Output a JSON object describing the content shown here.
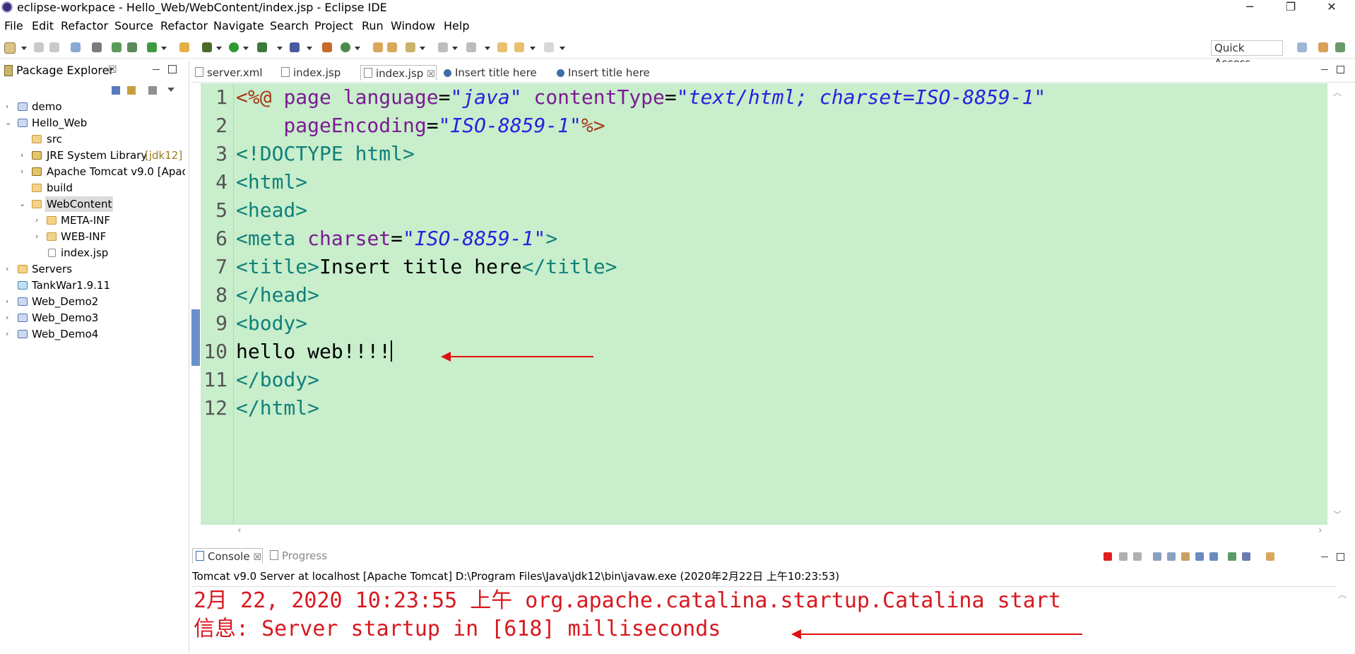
{
  "window": {
    "title": "eclipse-workpace - Hello_Web/WebContent/index.jsp - Eclipse IDE",
    "minimize": "─",
    "restore": "❐",
    "close": "✕"
  },
  "menu": [
    "File",
    "Edit",
    "Refactor",
    "Source",
    "Refactor",
    "Navigate",
    "Search",
    "Project",
    "Run",
    "Window",
    "Help"
  ],
  "toolbar": {
    "quick_access": "Quick Access"
  },
  "package_explorer": {
    "title": "Package Explorer",
    "close": "☒",
    "items": [
      {
        "label": "demo",
        "extra": ""
      },
      {
        "label": "Hello_Web",
        "extra": ""
      },
      {
        "label": "src",
        "extra": ""
      },
      {
        "label": "JRE System Library",
        "extra": "[jdk12]"
      },
      {
        "label": "Apache Tomcat v9.0 [Apac",
        "extra": ""
      },
      {
        "label": "build",
        "extra": ""
      },
      {
        "label": "WebContent",
        "extra": ""
      },
      {
        "label": "META-INF",
        "extra": ""
      },
      {
        "label": "WEB-INF",
        "extra": ""
      },
      {
        "label": "index.jsp",
        "extra": ""
      },
      {
        "label": "Servers",
        "extra": ""
      },
      {
        "label": "TankWar1.9.11",
        "extra": ""
      },
      {
        "label": "Web_Demo2",
        "extra": ""
      },
      {
        "label": "Web_Demo3",
        "extra": ""
      },
      {
        "label": "Web_Demo4",
        "extra": ""
      }
    ]
  },
  "editor": {
    "tabs": [
      "server.xml",
      "index.jsp",
      "index.jsp",
      "Insert title here",
      "Insert title here"
    ],
    "tab_close": "☒",
    "line_numbers": [
      "1",
      "2",
      "3",
      "4",
      "5",
      "6",
      "7",
      "8",
      "9",
      "10",
      "11",
      "12"
    ],
    "code": {
      "l1": [
        "<%@ ",
        "page ",
        "language",
        "=",
        "\"java\"",
        " contentType",
        "=",
        "\"text/html; charset=ISO-8859-1\""
      ],
      "l2": [
        "    pageEncoding",
        "=",
        "\"ISO-8859-1\"",
        "%>"
      ],
      "l3": [
        "<!DOCTYPE ",
        "html",
        ">"
      ],
      "l4": "<html>",
      "l5": "<head>",
      "l6": [
        "<meta ",
        "charset",
        "=",
        "\"ISO-8859-1\"",
        ">"
      ],
      "l7": [
        "<title>",
        "Insert title here",
        "</title>"
      ],
      "l8": "</head>",
      "l9": "<body>",
      "l10": "hello web!!!!",
      "l11": "</body>",
      "l12": "</html>"
    }
  },
  "console": {
    "tab_console": "Console",
    "tab_progress": "Progress",
    "info": "Tomcat v9.0 Server at localhost [Apache Tomcat] D:\\Program Files\\Java\\jdk12\\bin\\javaw.exe (2020年2月22日 上午10:23:53)",
    "line1": "2月 22, 2020 10:23:55 上午 org.apache.catalina.startup.Catalina start",
    "line2": "信息: Server startup in [618] milliseconds"
  },
  "colors": {
    "editor_bg": "#c8eecb",
    "tag": "#11807a",
    "attribute": "#7c1a94",
    "string": "#2a1fe0",
    "console_text": "#d8181f",
    "annotation_arrow": "#e01010"
  }
}
